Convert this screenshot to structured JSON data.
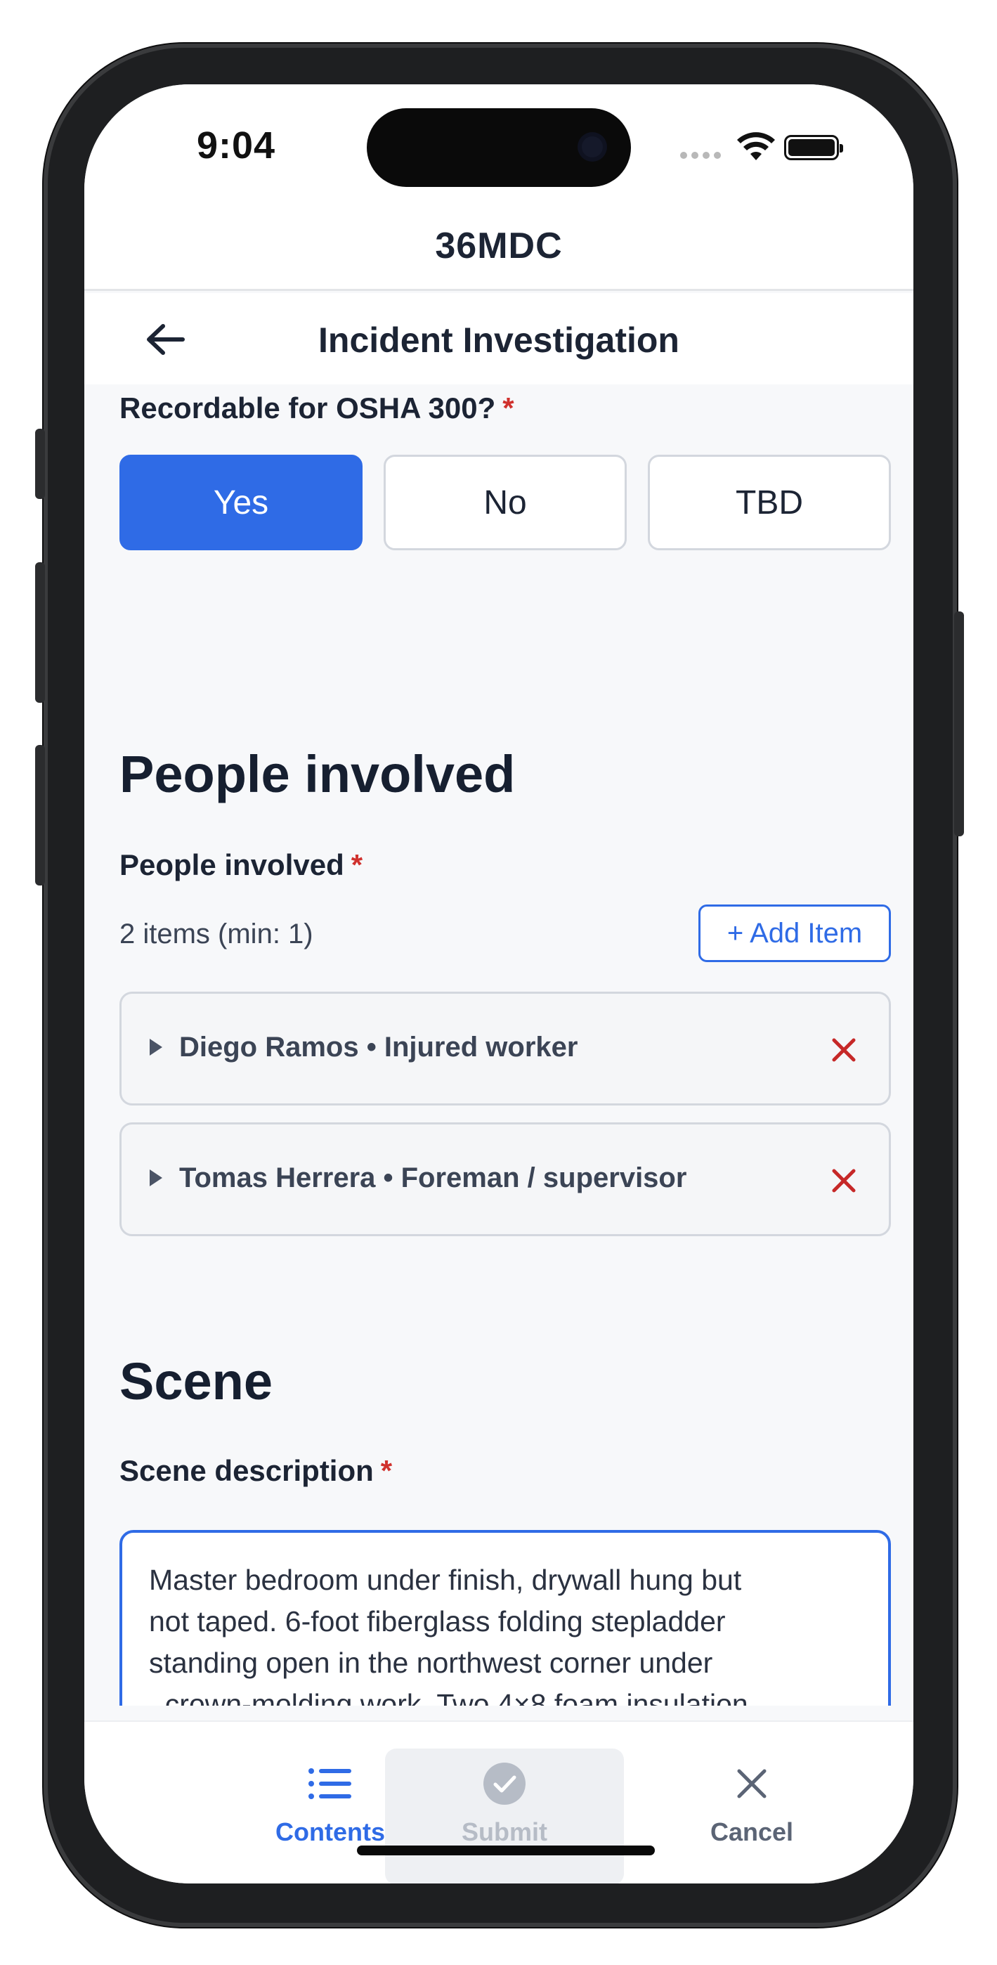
{
  "status_bar": {
    "time": "9:04"
  },
  "app": {
    "title": "36MDC"
  },
  "nav": {
    "title": "Incident Investigation"
  },
  "osha": {
    "label": "Recordable for OSHA 300?",
    "required_mark": "*",
    "options": [
      "Yes",
      "No",
      "TBD"
    ],
    "selected": "Yes"
  },
  "people_section": {
    "heading": "People involved",
    "field_label": "People involved",
    "required_mark": "*",
    "count_text": "2 items (min: 1)",
    "add_button": "+ Add Item",
    "items": [
      {
        "label": "Diego Ramos • Injured worker"
      },
      {
        "label": "Tomas Herrera • Foreman / supervisor"
      }
    ]
  },
  "scene_section": {
    "heading": "Scene",
    "field_label": "Scene description",
    "required_mark": "*",
    "description": "Master bedroom under finish, drywall hung but\nnot taped. 6-foot fiberglass folding stepladder\nstanding open in the northwest corner under\n  crown-molding work. Two 4×8 foam insulation\npanels stacked unevenly on the plywood\nsubfloor; the rear leg of the ladder was resting on"
  },
  "tabbar": {
    "contents": "Contents",
    "submit": "Submit",
    "cancel": "Cancel"
  },
  "colors": {
    "accent": "#2f6be6",
    "required": "#d0312d",
    "remove": "#c62828"
  }
}
